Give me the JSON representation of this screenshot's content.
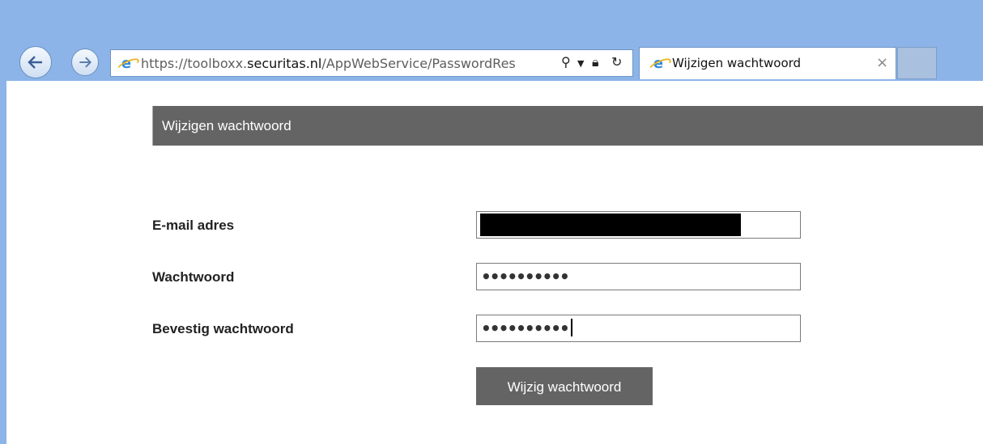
{
  "browser": {
    "url_scheme": "https://",
    "url_sub": "toolboxx.",
    "url_domain": "securitas.nl",
    "url_path": "/AppWebService/PasswordRes",
    "tab_title": "Wijzigen wachtwoord",
    "tab_close": "×",
    "icons": [
      "back-arrow-icon",
      "forward-arrow-icon",
      "ie-logo-icon",
      "search-icon",
      "dropdown-icon",
      "lock-icon",
      "refresh-icon",
      "close-icon"
    ],
    "accent": "#8cb4e8"
  },
  "page": {
    "header_title": "Wijzigen wachtwoord",
    "header_color": "#646464",
    "form": {
      "email_label": "E-mail adres",
      "password_label": "Wachtwoord",
      "password_value": "••••••••••",
      "confirm_label": "Bevestig wachtwoord",
      "confirm_value": "••••••••••",
      "submit_label": "Wijzig wachtwoord"
    }
  }
}
